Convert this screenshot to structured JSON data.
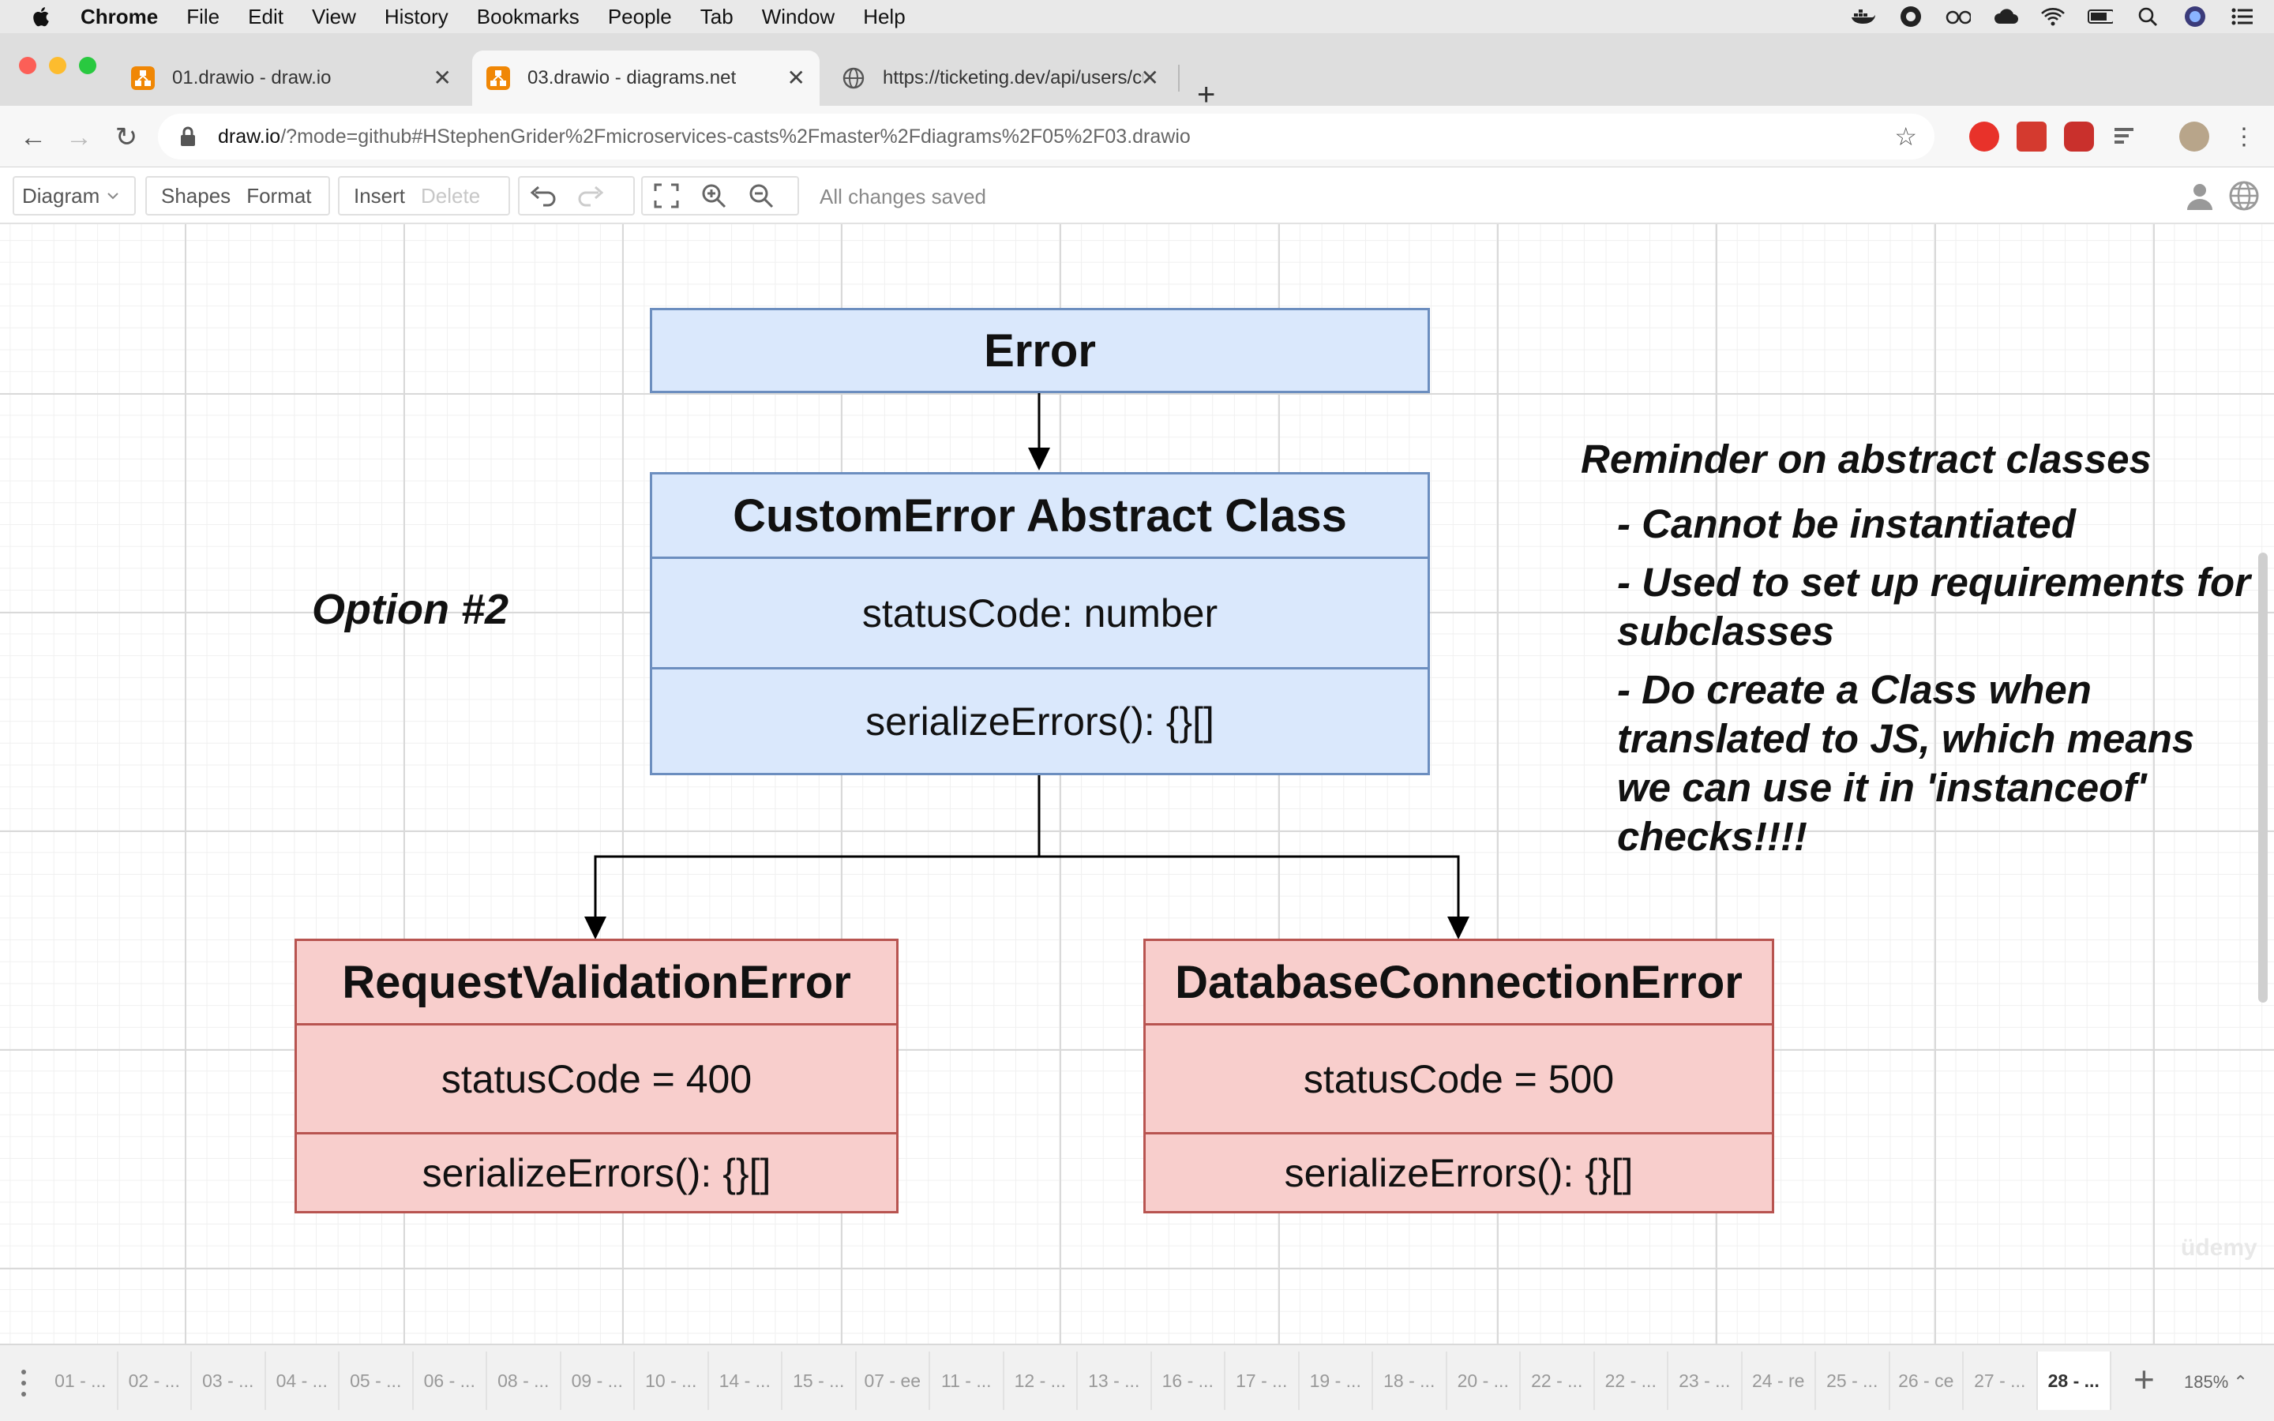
{
  "menubar": {
    "app": "Chrome",
    "items": [
      "File",
      "Edit",
      "View",
      "History",
      "Bookmarks",
      "People",
      "Tab",
      "Window",
      "Help"
    ]
  },
  "tabs": [
    {
      "title": "01.drawio - draw.io",
      "favicon": "drawio-icon"
    },
    {
      "title": "03.drawio - diagrams.net",
      "favicon": "drawio-icon"
    },
    {
      "title": "https://ticketing.dev/api/users/cu",
      "favicon": "globe-icon"
    }
  ],
  "address": {
    "host": "draw.io",
    "path": "/?mode=github#HStephenGrider%2Fmicroservices-casts%2Fmaster%2Fdiagrams%2F05%2F03.drawio"
  },
  "toolbar": {
    "diagram": "Diagram",
    "shapes": "Shapes",
    "format": "Format",
    "insert": "Insert",
    "delete": "Delete",
    "status": "All changes saved"
  },
  "diagram": {
    "error_class": "Error",
    "custom_error": {
      "title": "CustomError Abstract Class",
      "property": "statusCode: number",
      "method": "serializeErrors(): {}[]"
    },
    "request_validation": {
      "title": "RequestValidationError",
      "property": "statusCode = 400",
      "method": "serializeErrors(): {}[]"
    },
    "database_connection": {
      "title": "DatabaseConnectionError",
      "property": "statusCode = 500",
      "method": "serializeErrors(): {}[]"
    },
    "option_label": "Option #2",
    "note": {
      "title": "Reminder on abstract classes",
      "items": [
        "- Cannot be instantiated",
        "- Used to set up requirements for subclasses",
        "- Do create a Class when translated to JS, which means we can use it in 'instanceof' checks!!!!"
      ]
    },
    "colors": {
      "blue_fill": "#dae8fc",
      "blue_stroke": "#6c8ebf",
      "red_fill": "#f8cecc",
      "red_stroke": "#b85450"
    }
  },
  "watermark": "üdemy",
  "pages": [
    "01 - ...",
    "02 - ...",
    "03 - ...",
    "04 - ...",
    "05 - ...",
    "06 - ...",
    "08 - ...",
    "09 - ...",
    "10 - ...",
    "14 - ...",
    "15 - ...",
    "07 - ee",
    "11 - ...",
    "12 - ...",
    "13 - ...",
    "16 - ...",
    "17 - ...",
    "19 - ...",
    "18 - ...",
    "20 - ...",
    "22 - ...",
    "22 - ...",
    "23 - ...",
    "24 - re",
    "25 - ...",
    "26 - ce",
    "27 - ...",
    "28 - ..."
  ],
  "active_page": "28 - ...",
  "zoom": "185%"
}
